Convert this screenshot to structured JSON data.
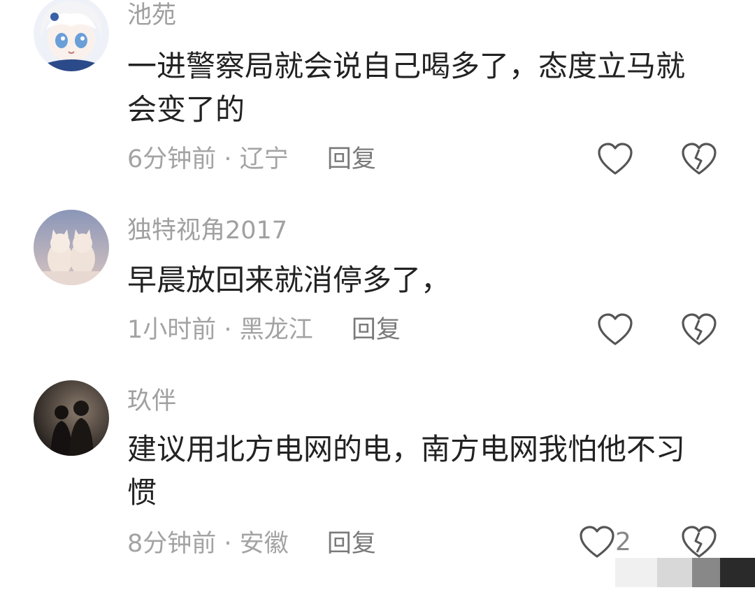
{
  "comments": [
    {
      "username": "池苑",
      "content": "一进警察局就会说自己喝多了，态度立马就会变了的",
      "time": "6分钟前",
      "location": "辽宁",
      "reply_label": "回复",
      "avatar_icon": "anime-avatar"
    },
    {
      "username": "独特视角2017",
      "content": "早晨放回来就消停多了，",
      "time": "1小时前",
      "location": "黑龙江",
      "reply_label": "回复",
      "avatar_icon": "cats-avatar"
    },
    {
      "username": "玖伴",
      "content": "建议用北方电网的电，南方电网我怕他不习惯",
      "time": "8分钟前",
      "location": "安徽",
      "reply_label": "回复",
      "like_count": "2",
      "avatar_icon": "couple-silhouette-avatar"
    }
  ],
  "separator": "·",
  "icons": {
    "like": "heart-outline-icon",
    "dislike": "broken-heart-icon"
  },
  "colors": {
    "username": "#a0a0a0",
    "content": "#222222",
    "meta": "#a3a3a3",
    "icon": "#555555"
  }
}
